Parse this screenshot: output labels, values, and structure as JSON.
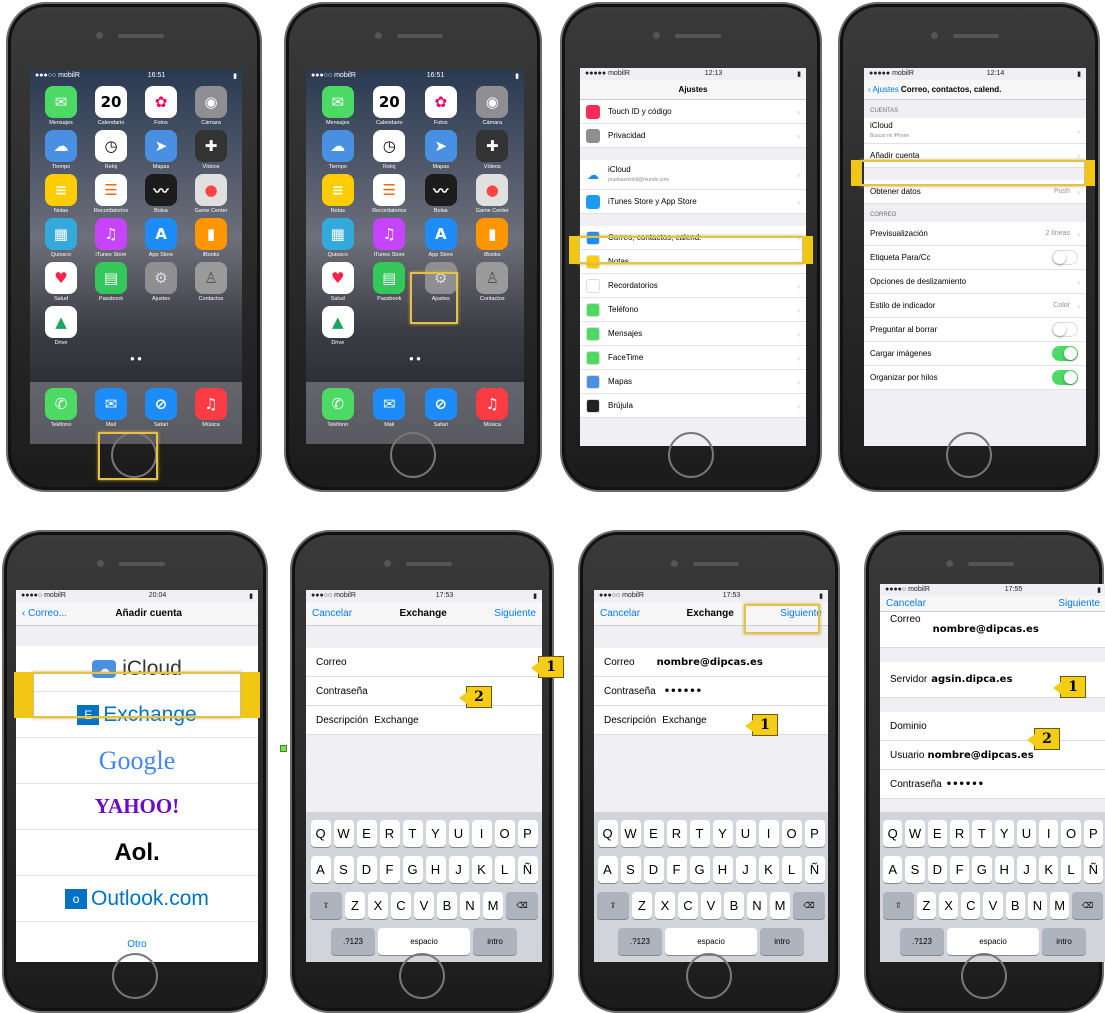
{
  "carrier": "mobilR",
  "phone1": {
    "time": "16:51",
    "apps": [
      "Mensajes",
      "Calendario",
      "Fotos",
      "Cámara",
      "Tiempo",
      "Reloj",
      "Mapas",
      "Vídeos",
      "Notas",
      "Recordatorios",
      "Bolsa",
      "Game Center",
      "Quiosco",
      "iTunes Store",
      "App Store",
      "iBooks",
      "Salud",
      "Passbook",
      "Ajustes",
      "Contactos",
      "Drive"
    ],
    "dock": [
      "Teléfono",
      "Mail",
      "Safari",
      "Música"
    ],
    "calendar_day": "20"
  },
  "phone3": {
    "time": "12:13",
    "title": "Ajustes",
    "rows": [
      "Touch ID y código",
      "Privacidad"
    ],
    "icloud_label": "iCloud",
    "icloud_sub": "pruebasmobil@mundo.com",
    "itunes": "iTunes Store y App Store",
    "rows2": [
      "Correo, contactos, calend.",
      "Notas",
      "Recordatorios",
      "Teléfono",
      "Mensajes",
      "FaceTime",
      "Mapas",
      "Brújula"
    ]
  },
  "phone4": {
    "time": "12:14",
    "back": "Ajustes",
    "title": "Correo, contactos, calend.",
    "sec_cuentas": "CUENTAS",
    "icloud": "iCloud",
    "icloud_sub": "Buscar mi iPhone",
    "add_account": "Añadir cuenta",
    "fetch": "Obtener datos",
    "fetch_value": "Push",
    "sec_correo": "CORREO",
    "rows": [
      {
        "label": "Previsualización",
        "value": "2 líneas"
      },
      {
        "label": "Etiqueta Para/Cc",
        "toggle": "off"
      },
      {
        "label": "Opciones de deslizamiento",
        "value": ""
      },
      {
        "label": "Estilo de indicador",
        "value": "Color"
      },
      {
        "label": "Preguntar al borrar",
        "toggle": "off"
      },
      {
        "label": "Cargar imágenes",
        "toggle": "on"
      },
      {
        "label": "Organizar por hilos",
        "toggle": "on"
      }
    ]
  },
  "phone5": {
    "time": "20:04",
    "back": "Correo...",
    "title": "Añadir cuenta",
    "providers": [
      "iCloud",
      "Exchange",
      "Google",
      "YAHOO!",
      "Aol.",
      "Outlook.com"
    ],
    "other": "Otro"
  },
  "phone6": {
    "time": "17:53",
    "cancel": "Cancelar",
    "title": "Exchange",
    "next": "Siguiente",
    "email_label": "Correo",
    "password_label": "Contraseña",
    "description_label": "Descripción",
    "description_value": "Exchange"
  },
  "phone7": {
    "time": "17:53",
    "cancel": "Cancelar",
    "title": "Exchange",
    "next": "Siguiente",
    "email_label": "Correo",
    "email_value": "nombre@dipcas.es",
    "password_label": "Contraseña",
    "password_value": "••••••",
    "description_label": "Descripción",
    "description_value": "Exchange"
  },
  "phone8": {
    "time": "17:55",
    "cancel": "Cancelar",
    "next": "Siguiente",
    "email_label": "Correo",
    "email_value": "nombre@dipcas.es",
    "server_label": "Servidor",
    "server_value": "agsin.dipca.es",
    "domain_label": "Dominio",
    "user_label": "Usuario",
    "user_value": "nombre@dipcas.es",
    "password_label": "Contraseña",
    "password_value": "••••••"
  },
  "keyboard": {
    "row1": [
      "Q",
      "W",
      "E",
      "R",
      "T",
      "Y",
      "U",
      "I",
      "O",
      "P"
    ],
    "row2": [
      "A",
      "S",
      "D",
      "F",
      "G",
      "H",
      "J",
      "K",
      "L",
      "Ñ"
    ],
    "row3": [
      "Z",
      "X",
      "C",
      "V",
      "B",
      "N",
      "M"
    ],
    "shift": "⇧",
    "del": "⌫",
    "num": ".?123",
    "space": "espacio",
    "enter": "intro"
  },
  "badges": {
    "one": "1",
    "two": "2"
  },
  "colors": {
    "highlight": "#f2c713",
    "ios_blue": "#007aff",
    "toggle_on": "#4cd964"
  }
}
